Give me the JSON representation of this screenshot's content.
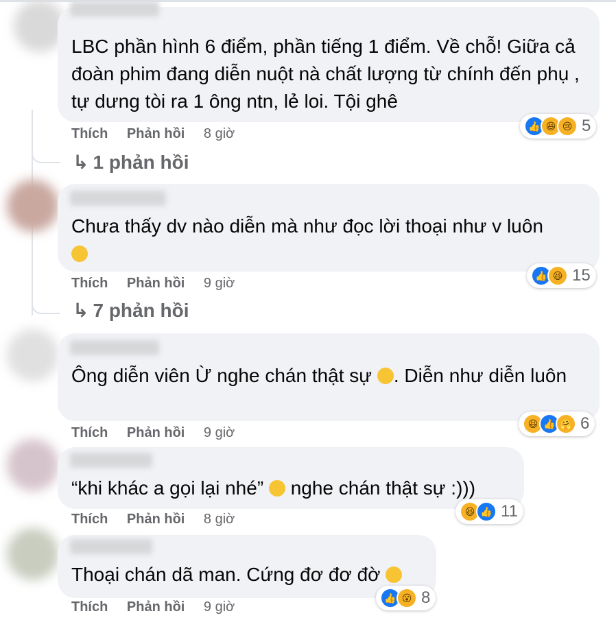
{
  "comments": [
    {
      "text": "LBC phần hình 6 điểm, phần tiếng 1 điểm. Về chỗ! Giữa cả đoàn phim đang diễn nuột nà chất lượng từ chính đến phụ , tự dưng tòi ra 1 ông ntn, lẻ loi. Tội ghê",
      "like_label": "Thích",
      "reply_label": "Phản hồi",
      "time": "8 giờ",
      "reactions": [
        "like",
        "haha",
        "sad"
      ],
      "reaction_count": "5",
      "replies": "1 phản hồi"
    },
    {
      "text": "Chưa thấy dv nào diễn mà như đọc lời thoại như v luôn",
      "emoji": "neutral-face",
      "like_label": "Thích",
      "reply_label": "Phản hồi",
      "time": "9 giờ",
      "reactions": [
        "like",
        "haha"
      ],
      "reaction_count": "15",
      "replies": "7 phản hồi"
    },
    {
      "text_before": "Ông diễn viên Ừ nghe chán thật sự",
      "text_after": ". Diễn như diễn luôn",
      "emoji": "tears-of-joy",
      "like_label": "Thích",
      "reply_label": "Phản hồi",
      "time": "9 giờ",
      "reactions": [
        "haha",
        "like",
        "care"
      ],
      "reaction_count": "6"
    },
    {
      "text_before": "“khi khác a gọi lại nhé”",
      "text_after": "nghe chán thật sự :)))",
      "emoji": "sad-face",
      "like_label": "Thích",
      "reply_label": "Phản hồi",
      "time": "8 giờ",
      "reactions": [
        "haha",
        "like"
      ],
      "reaction_count": "11"
    },
    {
      "text": "Thoại chán dã man. Cứng đơ đơ đờ",
      "emoji": "rolling-laughing",
      "like_label": "Thích",
      "reply_label": "Phản hồi",
      "time": "9 giờ",
      "reactions": [
        "like",
        "wow"
      ],
      "reaction_count": "8"
    }
  ],
  "colors": {
    "bubble": "#f0f2f5",
    "meta": "#65676b",
    "like": "#1877f2",
    "text": "#050505"
  }
}
